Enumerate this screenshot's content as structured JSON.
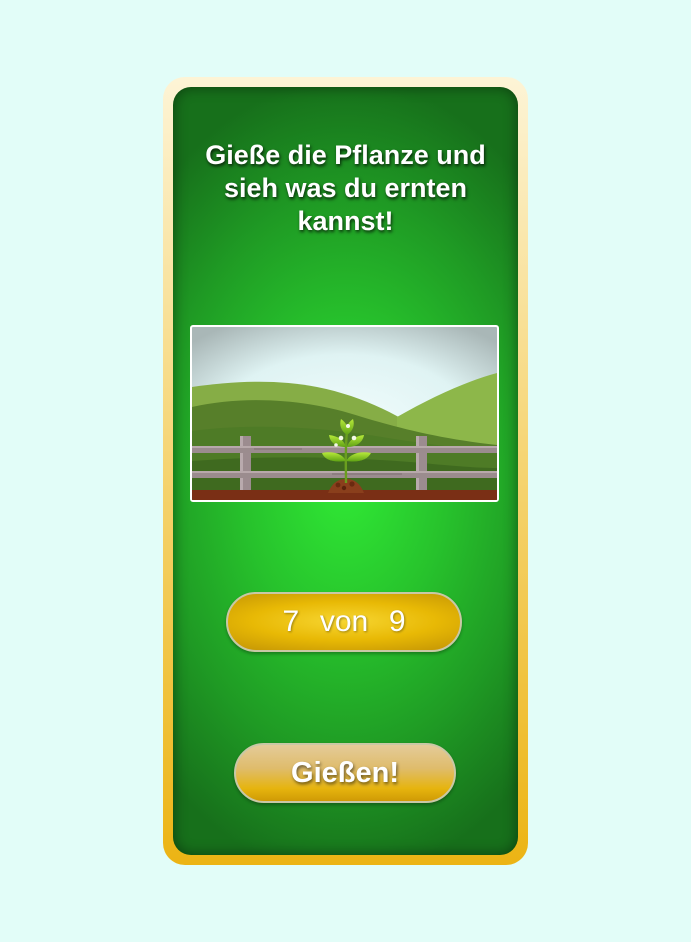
{
  "game": {
    "title": "Gieße die Pflanze und sieh was du ernten kannst!",
    "counter": {
      "current": "7",
      "separator": "von",
      "total": "9"
    },
    "water_button_label": "Gießen!"
  },
  "colors": {
    "background": "#e2fdf8",
    "panel_green": "#27c22c",
    "frame_gold": "#ecb414",
    "counter_gold": "#e8b905",
    "text": "#ffffff"
  },
  "scene": {
    "elements": [
      "sky",
      "rolling-hills",
      "wooden-fence",
      "seedling-plant",
      "soil-mound"
    ]
  }
}
